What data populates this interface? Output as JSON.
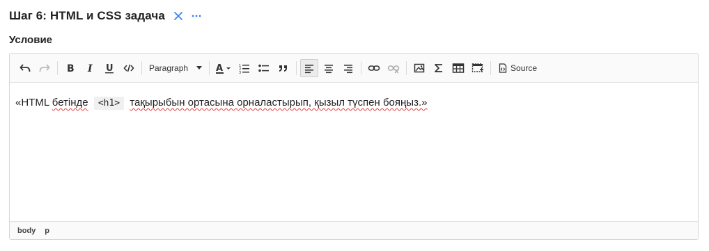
{
  "header": {
    "title": "Шаг 6: HTML и CSS задача",
    "close_icon": "close-icon",
    "more_icon": "more-icon"
  },
  "section": {
    "label": "Условие"
  },
  "toolbar": {
    "block_format": "Paragraph",
    "source_label": "Source",
    "icons": [
      "undo-icon",
      "redo-icon",
      "bold-icon",
      "italic-icon",
      "underline-icon",
      "code-icon",
      "font-color-icon",
      "numbered-list-icon",
      "bullet-list-icon",
      "blockquote-icon",
      "align-left-icon",
      "align-center-icon",
      "align-right-icon",
      "link-icon",
      "unlink-icon",
      "image-icon",
      "formula-icon",
      "table-icon",
      "template-icon",
      "source-icon"
    ],
    "active": "align-left"
  },
  "content": {
    "before_code": "«HTML ",
    "word1": "бетінде",
    "code": "<h1>",
    "after_code": "тақырыбын ортасына орналастырып, қызыл түспен бояңыз.»"
  },
  "statusbar": {
    "path": [
      "body",
      "p"
    ]
  },
  "colors": {
    "accent": "#3b82f6",
    "spellcheck": "#e23b3b"
  }
}
